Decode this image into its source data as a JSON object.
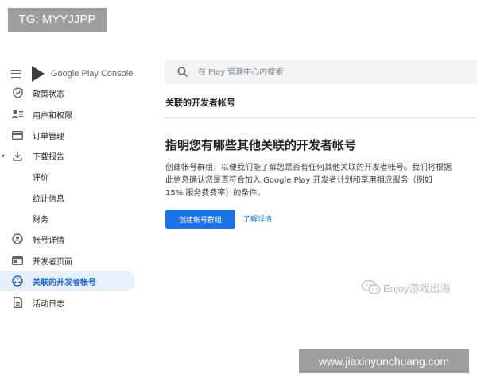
{
  "badge": "TG: MYYJJPP",
  "brand": {
    "name": "Google Play Console"
  },
  "sidebar": {
    "items": [
      {
        "label": "政策状态",
        "icon": "shield-icon"
      },
      {
        "label": "用户和权限",
        "icon": "users-icon"
      },
      {
        "label": "订单管理",
        "icon": "orders-icon"
      },
      {
        "label": "下载报告",
        "icon": "download-icon",
        "expanded": true
      },
      {
        "label": "评价",
        "sub": true
      },
      {
        "label": "统计信息",
        "sub": true
      },
      {
        "label": "财务",
        "sub": true
      },
      {
        "label": "帐号详情",
        "icon": "account-icon"
      },
      {
        "label": "开发者页面",
        "icon": "developer-page-icon"
      },
      {
        "label": "关联的开发者帐号",
        "icon": "linked-accounts-icon",
        "active": true
      },
      {
        "label": "活动日志",
        "icon": "activity-log-icon"
      }
    ]
  },
  "search": {
    "placeholder": "在 Play 管理中心内搜索"
  },
  "main": {
    "section_title": "关联的开发者帐号",
    "card": {
      "heading": "指明您有哪些其他关联的开发者帐号",
      "body": "创建帐号群组，以便我们能了解您是否有任何其他关联的开发者帐号。我们将根据此信息确认您是否符合加入 Google Play 开发者计划和享用相应服务（例如 15% 服务费费率）的条件。",
      "primary_button": "创建帐号群组",
      "learn_more": "了解详情"
    }
  },
  "watermark": "Enjoy游戏出海",
  "url_banner": "www.jiaxinyunchuang.com",
  "colors": {
    "accent": "#1a73e8",
    "active_bg": "#e8f0fe",
    "active_text": "#1967d2"
  }
}
